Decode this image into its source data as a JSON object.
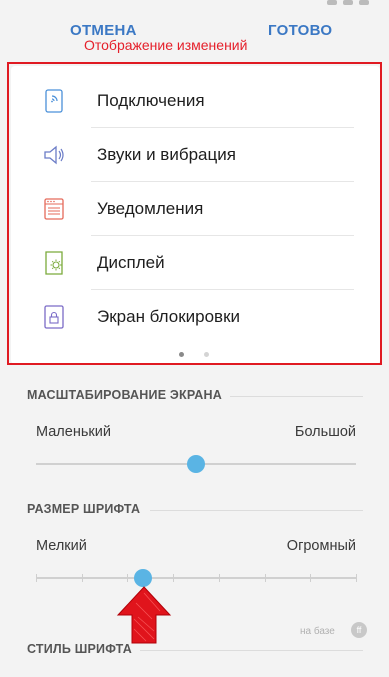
{
  "header": {
    "cancel_label": "ОТМЕНА",
    "done_label": "ГОТОВО",
    "annotation": "Отображение изменений"
  },
  "preview": {
    "items": [
      {
        "label": "Подключения",
        "icon": "connections-icon",
        "color": "#4a90d9"
      },
      {
        "label": "Звуки и вибрация",
        "icon": "speaker-icon",
        "color": "#6b7cc7"
      },
      {
        "label": "Уведомления",
        "icon": "notifications-icon",
        "color": "#e56a5a"
      },
      {
        "label": "Дисплей",
        "icon": "display-brightness-icon",
        "color": "#7bab3b"
      },
      {
        "label": "Экран блокировки",
        "icon": "lock-screen-icon",
        "color": "#7b6bc7"
      }
    ],
    "page_count": 2,
    "active_page": 1
  },
  "screen_zoom": {
    "title": "МАСШТАБИРОВАНИЕ ЭКРАНА",
    "min_label": "Маленький",
    "max_label": "Большой",
    "level": 0.5
  },
  "font_size": {
    "title": "РАЗМЕР ШРИФТА",
    "min_label": "Мелкий",
    "max_label": "Огромный",
    "steps": 8,
    "selected_step": 3
  },
  "font_style": {
    "title": "СТИЛЬ ШРИФТА",
    "note": "на базе"
  },
  "colors": {
    "accent": "#3b78c4",
    "slider_thumb": "#5ab4e4",
    "annotation_red": "#e01a22"
  }
}
